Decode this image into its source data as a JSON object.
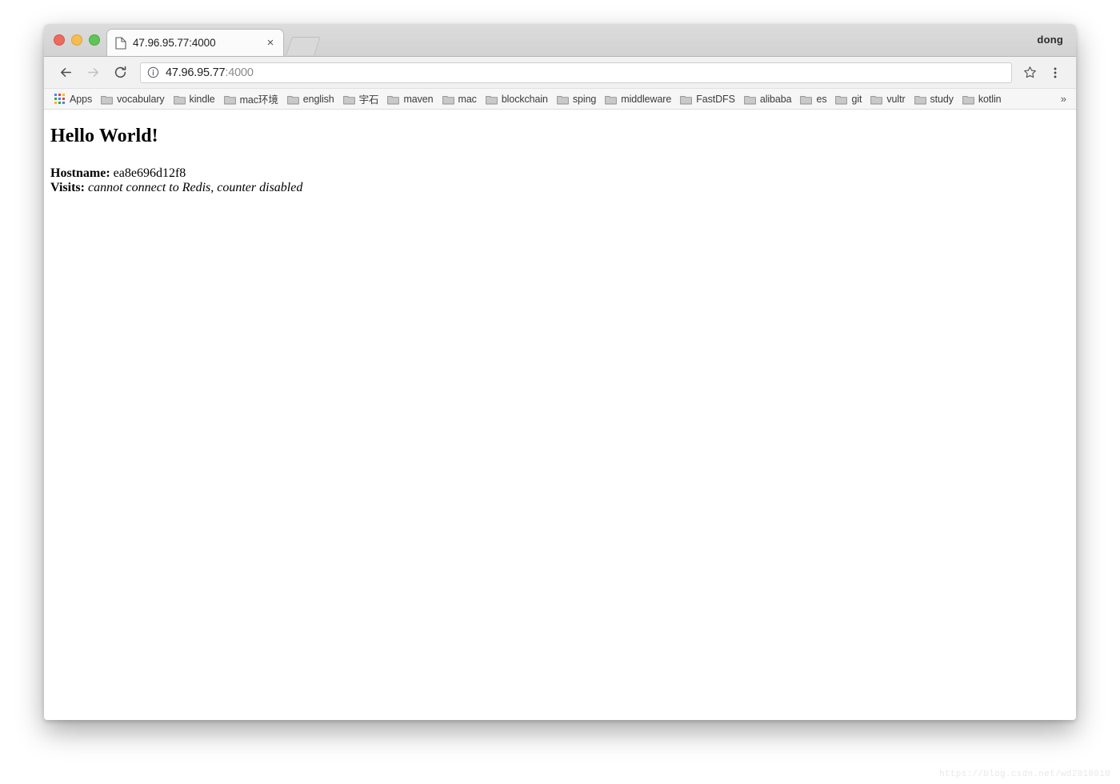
{
  "window": {
    "traffic_lights": [
      {
        "name": "close",
        "color": "#ec6a5e"
      },
      {
        "name": "minimize",
        "color": "#f5bd4f"
      },
      {
        "name": "maximize",
        "color": "#61c454"
      }
    ],
    "profile_name": "dong"
  },
  "tab": {
    "title": "47.96.95.77:4000",
    "close_label": "×",
    "favicon": "page-icon",
    "new_tab_label": ""
  },
  "toolbar": {
    "back_label": "←",
    "forward_label": "→",
    "reload_label": "↻",
    "site_info_icon": "info-circle-icon",
    "url_host": "47.96.95.77",
    "url_port": ":4000",
    "url_full": "47.96.95.77:4000",
    "star_label": "☆",
    "menu_label": "⋮"
  },
  "bookmarks": {
    "apps_label": "Apps",
    "overflow_label": "»",
    "items": [
      {
        "label": "vocabulary"
      },
      {
        "label": "kindle"
      },
      {
        "label": "mac环境"
      },
      {
        "label": "english"
      },
      {
        "label": "宇石"
      },
      {
        "label": "maven"
      },
      {
        "label": "mac"
      },
      {
        "label": "blockchain"
      },
      {
        "label": "sping"
      },
      {
        "label": "middleware"
      },
      {
        "label": "FastDFS"
      },
      {
        "label": "alibaba"
      },
      {
        "label": "es"
      },
      {
        "label": "git"
      },
      {
        "label": "vultr"
      },
      {
        "label": "study"
      },
      {
        "label": "kotlin"
      }
    ]
  },
  "page": {
    "heading": "Hello World!",
    "hostname_label": "Hostname:",
    "hostname_value": "ea8e696d12f8",
    "visits_label": "Visits:",
    "visits_value": "cannot connect to Redis, counter disabled"
  },
  "watermark": {
    "text": "https://blog.csdn.net/wd2018010"
  }
}
